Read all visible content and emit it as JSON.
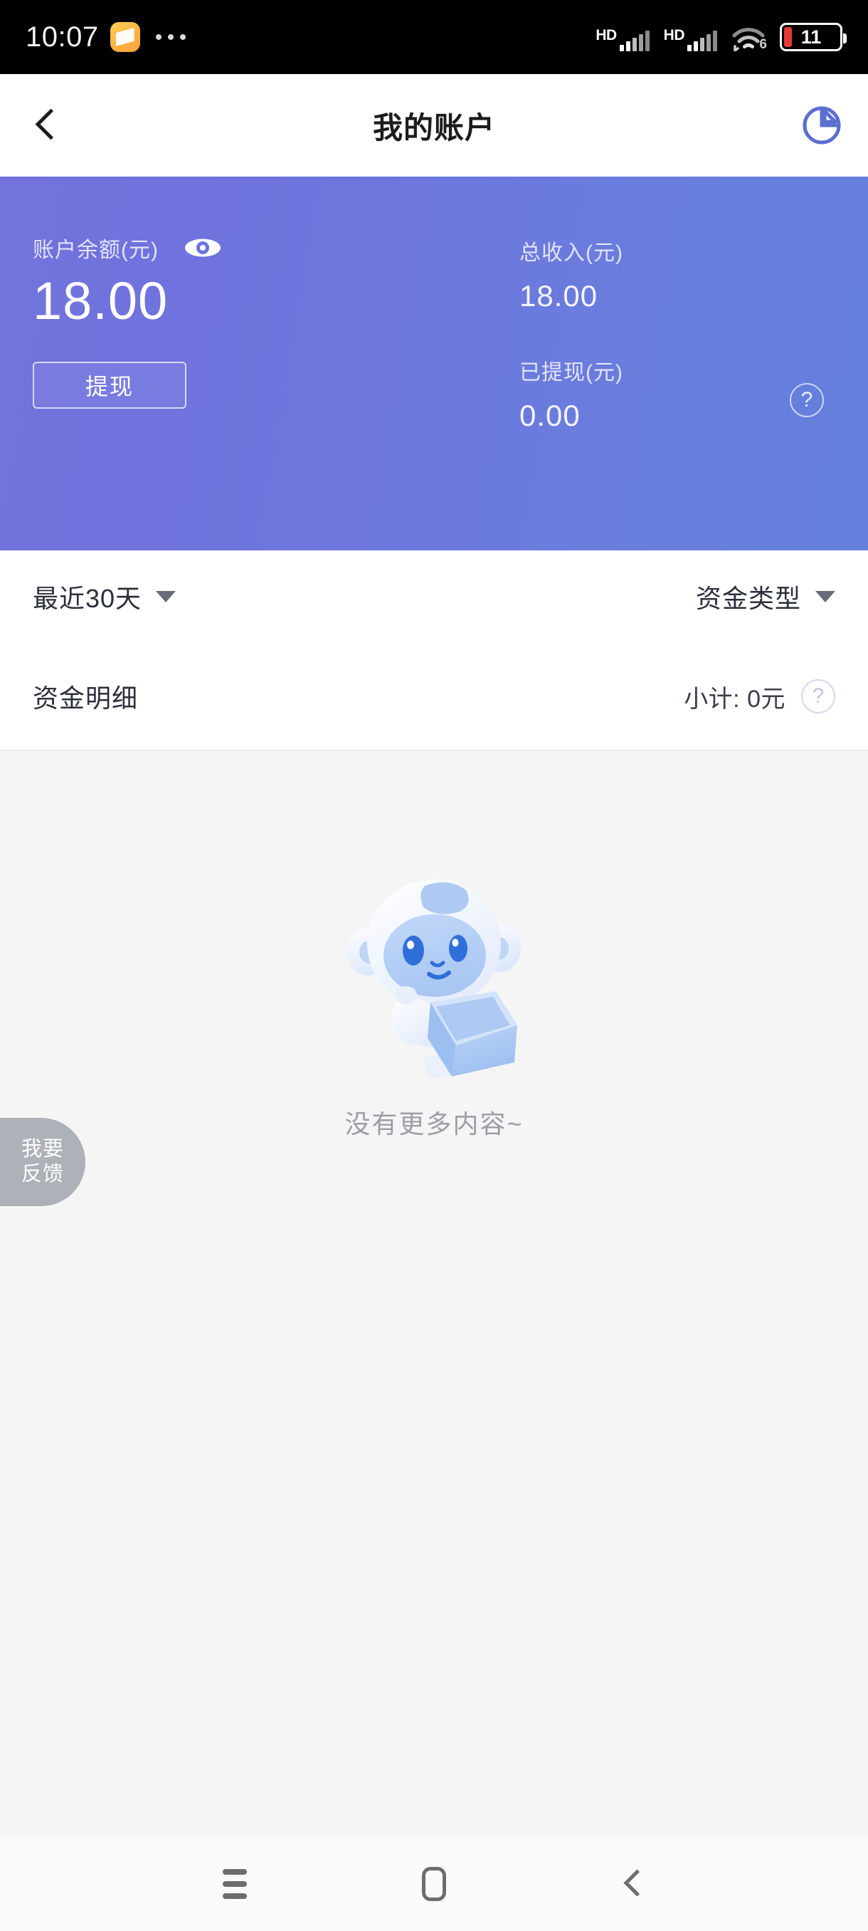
{
  "statusbar": {
    "time": "10:07",
    "app_icon": "note-app-icon",
    "overflow": "more-dots-icon",
    "signal_1_label": "HD",
    "signal_2_label": "HD",
    "wifi_generation": "6",
    "battery_percent": "11"
  },
  "header": {
    "back": "back-chevron-icon",
    "title": "我的账户",
    "chart_icon": "pie-chart-icon"
  },
  "card": {
    "balance_label": "账户余额(元)",
    "balance_value": "18.00",
    "eye_icon": "eye-visible-icon",
    "withdraw_label": "提现",
    "income_label": "总收入(元)",
    "income_value": "18.00",
    "withdrawn_label": "已提现(元)",
    "withdrawn_value": "0.00",
    "help_icon": "?",
    "gradient_from": "#7273dd",
    "gradient_to": "#6480dc"
  },
  "filters": {
    "date_range": "最近30天",
    "fund_type": "资金类型"
  },
  "detail": {
    "title": "资金明细",
    "subtotal": "小计: 0元",
    "help_icon": "?"
  },
  "empty_state": {
    "illustration": "monkey-with-empty-box-illustration",
    "text": "没有更多内容~"
  },
  "feedback": {
    "line1": "我要",
    "line2": "反馈"
  },
  "navbar": {
    "recents": "recents-icon",
    "home": "home-icon",
    "back": "back-icon"
  }
}
